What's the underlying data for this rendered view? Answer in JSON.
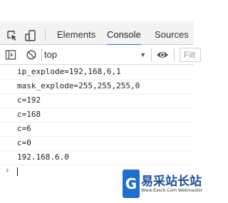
{
  "devtools": {
    "tabs": [
      {
        "label": "Elements",
        "active": false
      },
      {
        "label": "Console",
        "active": true
      },
      {
        "label": "Sources",
        "active": false
      }
    ]
  },
  "console_toolbar": {
    "context_value": "top",
    "filter_placeholder": "Filt"
  },
  "logs": [
    "ip_explode=192,168,6,1",
    "mask_explode=255,255,255,0",
    "c=192",
    "c=168",
    "c=6",
    "c=0",
    "192.168.6.0"
  ],
  "prompt": {
    "chevron": "›"
  },
  "watermark": {
    "logo_letter": "G",
    "title": "易采站长站",
    "subtitle": "Www.Easck.Com Webmaster"
  },
  "colors": {
    "accent": "#1a73e8",
    "tabs_bg": "#f3f3f3",
    "watermark_blue": "#1f6fd1"
  }
}
